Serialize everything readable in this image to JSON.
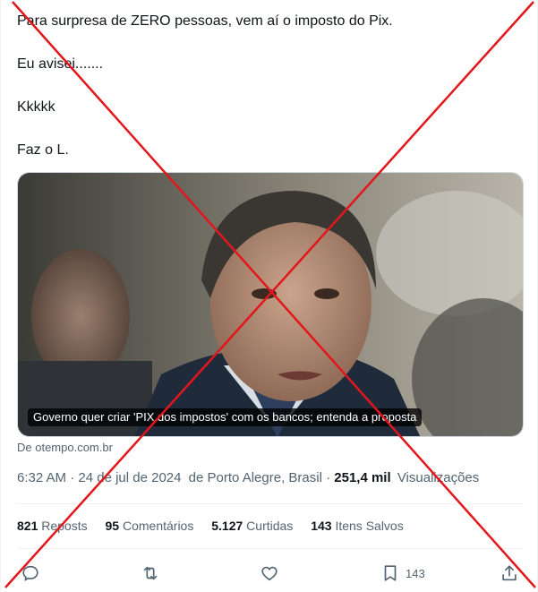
{
  "tweet": {
    "paragraphs": [
      "Para surpresa de ZERO pessoas, vem aí o imposto do Pix.",
      "Eu avisei.......",
      "Kkkkk",
      "Faz o L."
    ]
  },
  "card": {
    "caption": "Governo quer criar 'PIX dos impostos' com os bancos; entenda a proposta",
    "source": "De otempo.com.br"
  },
  "meta": {
    "time": "6:32 AM",
    "date": "24 de jul de 2024",
    "location": "de Porto Alegre, Brasil",
    "views_count": "251,4 mil",
    "views_label": "Visualizações"
  },
  "stats": {
    "reposts_count": "821",
    "reposts_label": "Reposts",
    "comments_count": "95",
    "comments_label": "Comentários",
    "likes_count": "5.127",
    "likes_label": "Curtidas",
    "saves_count": "143",
    "saves_label": "Itens Salvos"
  },
  "actions": {
    "bookmark_count": "143"
  },
  "colors": {
    "overlay_cross": "#e3161b",
    "text_secondary": "#536471",
    "text_primary": "#0f1419"
  },
  "icons": [
    "reply-icon",
    "repost-icon",
    "like-icon",
    "bookmark-icon",
    "share-icon"
  ]
}
